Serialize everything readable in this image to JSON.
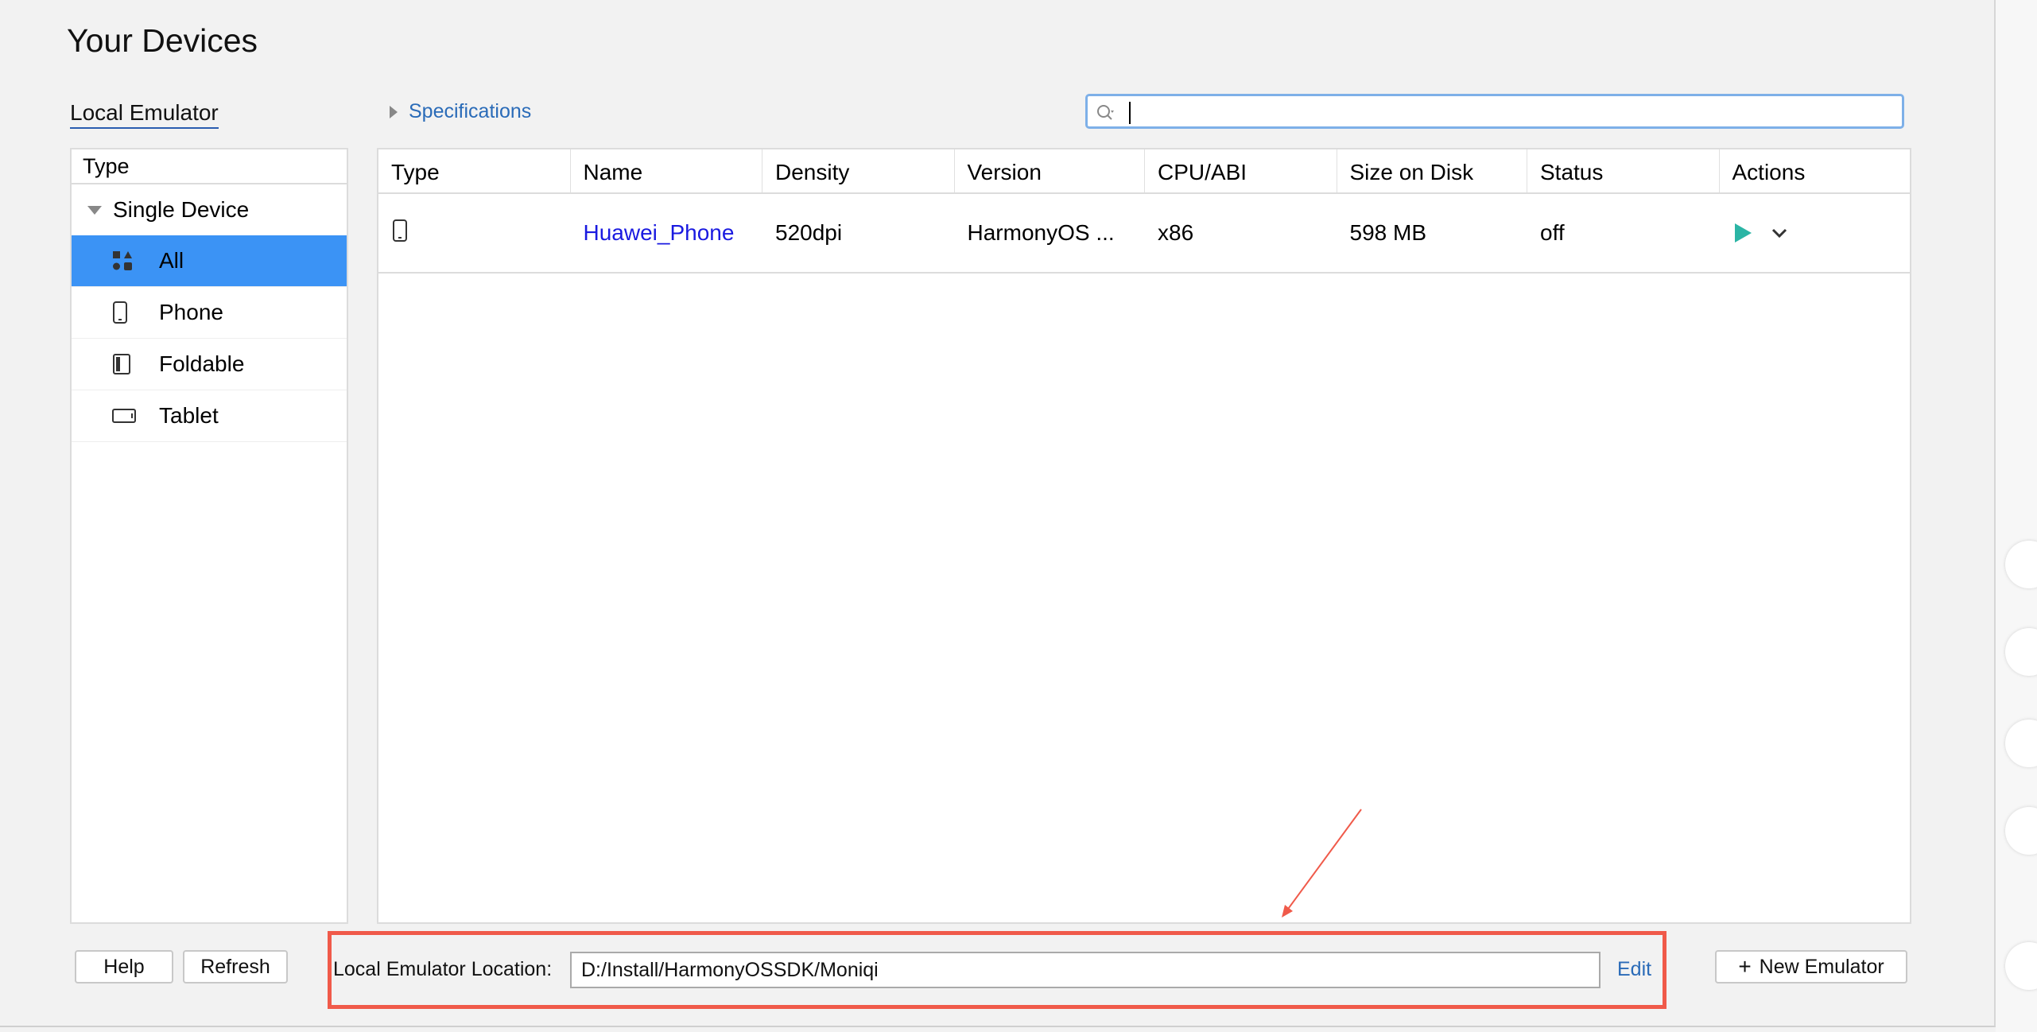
{
  "title": "Your Devices",
  "tabs": {
    "local_emulator": "Local Emulator"
  },
  "specifications_label": "Specifications",
  "search": {
    "value": "",
    "placeholder": ""
  },
  "left_panel": {
    "header": "Type",
    "group": "Single Device",
    "items": [
      {
        "label": "All",
        "icon": "grid-icon",
        "selected": true
      },
      {
        "label": "Phone",
        "icon": "phone-icon"
      },
      {
        "label": "Foldable",
        "icon": "foldable-icon"
      },
      {
        "label": "Tablet",
        "icon": "tablet-icon"
      }
    ]
  },
  "table": {
    "columns": [
      "Type",
      "Name",
      "Density",
      "Version",
      "CPU/ABI",
      "Size on Disk",
      "Status",
      "Actions"
    ],
    "rows": [
      {
        "type_icon": "phone-icon",
        "name": "Huawei_Phone",
        "density": "520dpi",
        "version": "HarmonyOS ...",
        "cpu": "x86",
        "size": "598 MB",
        "status": "off"
      }
    ]
  },
  "footer": {
    "help": "Help",
    "refresh": "Refresh",
    "location_label": "Local Emulator Location:",
    "location_value": "D:/Install/HarmonyOSSDK/Moniqi",
    "edit": "Edit",
    "new_emulator": "New Emulator"
  },
  "colors": {
    "selection": "#3b93f5",
    "link": "#1a1ae0",
    "accent_link": "#2a6bb8",
    "highlight_box": "#f05a4a",
    "play": "#2bb5a5"
  }
}
